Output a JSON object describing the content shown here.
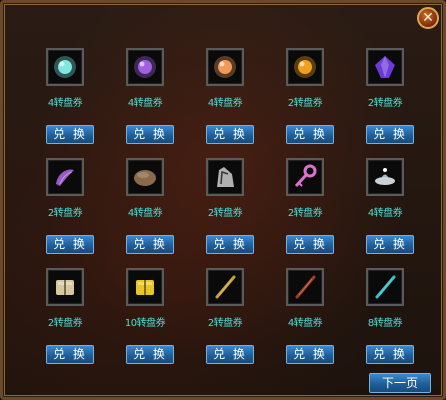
{
  "window": {
    "close_glyph": "✕"
  },
  "items": [
    {
      "icon": "cyan-orb-icon",
      "price": "4转盘券",
      "button": "兑 换",
      "color": "#7fe6e0"
    },
    {
      "icon": "purple-orb-icon",
      "price": "4转盘券",
      "button": "兑 换",
      "color": "#a060e0"
    },
    {
      "icon": "orange-orb-icon",
      "price": "4转盘券",
      "button": "兑 换",
      "color": "#f09a5a"
    },
    {
      "icon": "fire-orb-icon",
      "price": "2转盘券",
      "button": "兑 换",
      "color": "#f0a020"
    },
    {
      "icon": "violet-gem-icon",
      "price": "2转盘券",
      "button": "兑 换",
      "color": "#6b3ad8"
    },
    {
      "icon": "purple-claw-icon",
      "price": "2转盘券",
      "button": "兑 换",
      "color": "#9a58c8"
    },
    {
      "icon": "brown-stone-icon",
      "price": "4转盘券",
      "button": "兑 换",
      "color": "#8a6a4a"
    },
    {
      "icon": "silver-wing-icon",
      "price": "2转盘券",
      "button": "兑 换",
      "color": "#b0b0b0"
    },
    {
      "icon": "pink-key-icon",
      "price": "2转盘券",
      "button": "兑 换",
      "color": "#e070d0"
    },
    {
      "icon": "silver-lamp-icon",
      "price": "4转盘券",
      "button": "兑 换",
      "color": "#c8d0d8"
    },
    {
      "icon": "book-icon",
      "price": "2转盘券",
      "button": "兑 换",
      "color": "#d8c8a0"
    },
    {
      "icon": "gold-book-icon",
      "price": "10转盘券",
      "button": "兑 换",
      "color": "#e8c820"
    },
    {
      "icon": "gold-stick-icon",
      "price": "2转盘券",
      "button": "兑 换",
      "color": "#c8a030"
    },
    {
      "icon": "red-stick-icon",
      "price": "4转盘券",
      "button": "兑 换",
      "color": "#a03a20"
    },
    {
      "icon": "cyan-stick-icon",
      "price": "8转盘券",
      "button": "兑 换",
      "color": "#30c0c8"
    }
  ],
  "next_button": "下一页"
}
